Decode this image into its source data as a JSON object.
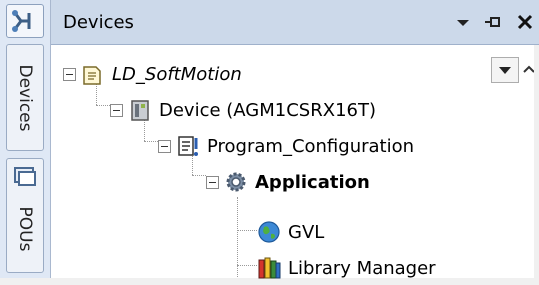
{
  "sidebar": {
    "tabs": [
      {
        "label": "Devices",
        "icon": "devices-tab-icon"
      },
      {
        "label": "POUs",
        "icon": "pous-tab-icon"
      }
    ]
  },
  "panel": {
    "title": "Devices",
    "buttons": {
      "dropdown": "chevron-down-icon",
      "pin": "pin-icon",
      "close": "close-icon"
    }
  },
  "tree": {
    "nodes": [
      {
        "label": "LD_SoftMotion",
        "icon": "project-icon",
        "style": "italic"
      },
      {
        "label": "Device (AGM1CSRX16T)",
        "icon": "device-icon"
      },
      {
        "label": "Program_Configuration",
        "icon": "program-config-icon"
      },
      {
        "label": "Application",
        "icon": "application-gear-icon",
        "style": "bold"
      },
      {
        "label": "GVL",
        "icon": "globe-icon"
      },
      {
        "label": "Library Manager",
        "icon": "library-books-icon"
      }
    ]
  }
}
